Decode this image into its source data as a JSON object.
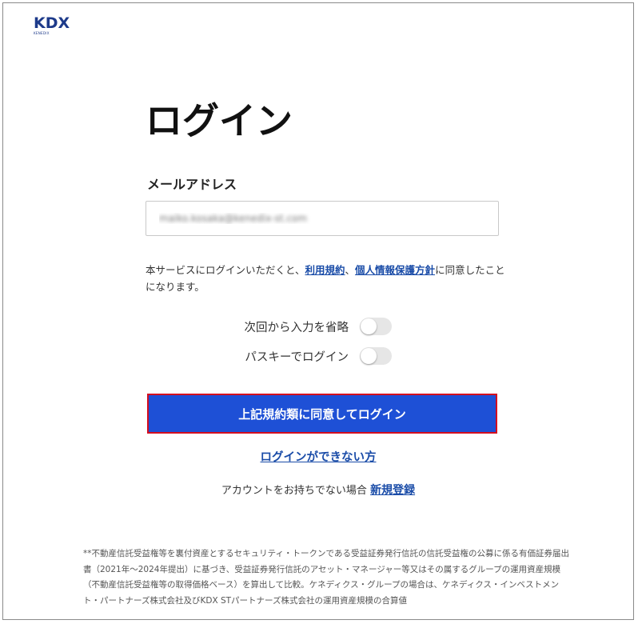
{
  "logo": {
    "main": "KDX",
    "sub": "KENEDIX"
  },
  "title": "ログイン",
  "email": {
    "label": "メールアドレス",
    "value": "maiko.kosaka@kenedix-st.com"
  },
  "consent": {
    "prefix": "本サービスにログインいただくと、",
    "terms_link": "利用規約",
    "separator": "、",
    "privacy_link": "個人情報保護方針",
    "suffix": "に同意したことになります。"
  },
  "toggles": [
    {
      "label": "次回から入力を省略",
      "on": false
    },
    {
      "label": "パスキーでログイン",
      "on": false
    }
  ],
  "submit_label": "上記規約類に同意してログイン",
  "cant_login_link": "ログインができない方",
  "register": {
    "prefix": "アカウントをお持ちでない場合",
    "link": "新規登録"
  },
  "footnote": "**不動産信託受益権等を裏付資産とするセキュリティ・トークンである受益証券発行信託の信託受益権の公募に係る有価証券届出書（2021年～2024年提出）に基づき、受益証券発行信託のアセット・マネージャー等又はその属するグループの運用資産規模（不動産信託受益権等の取得価格ベース）を算出して比較。ケネディクス・グループの場合は、ケネディクス・インベストメント・パートナーズ株式会社及びKDX STパートナーズ株式会社の運用資産規模の合算値",
  "colors": {
    "brand": "#1d3a8a",
    "primary_button": "#1e50d6",
    "button_border": "#d40d1f",
    "link": "#1a4ca8"
  }
}
